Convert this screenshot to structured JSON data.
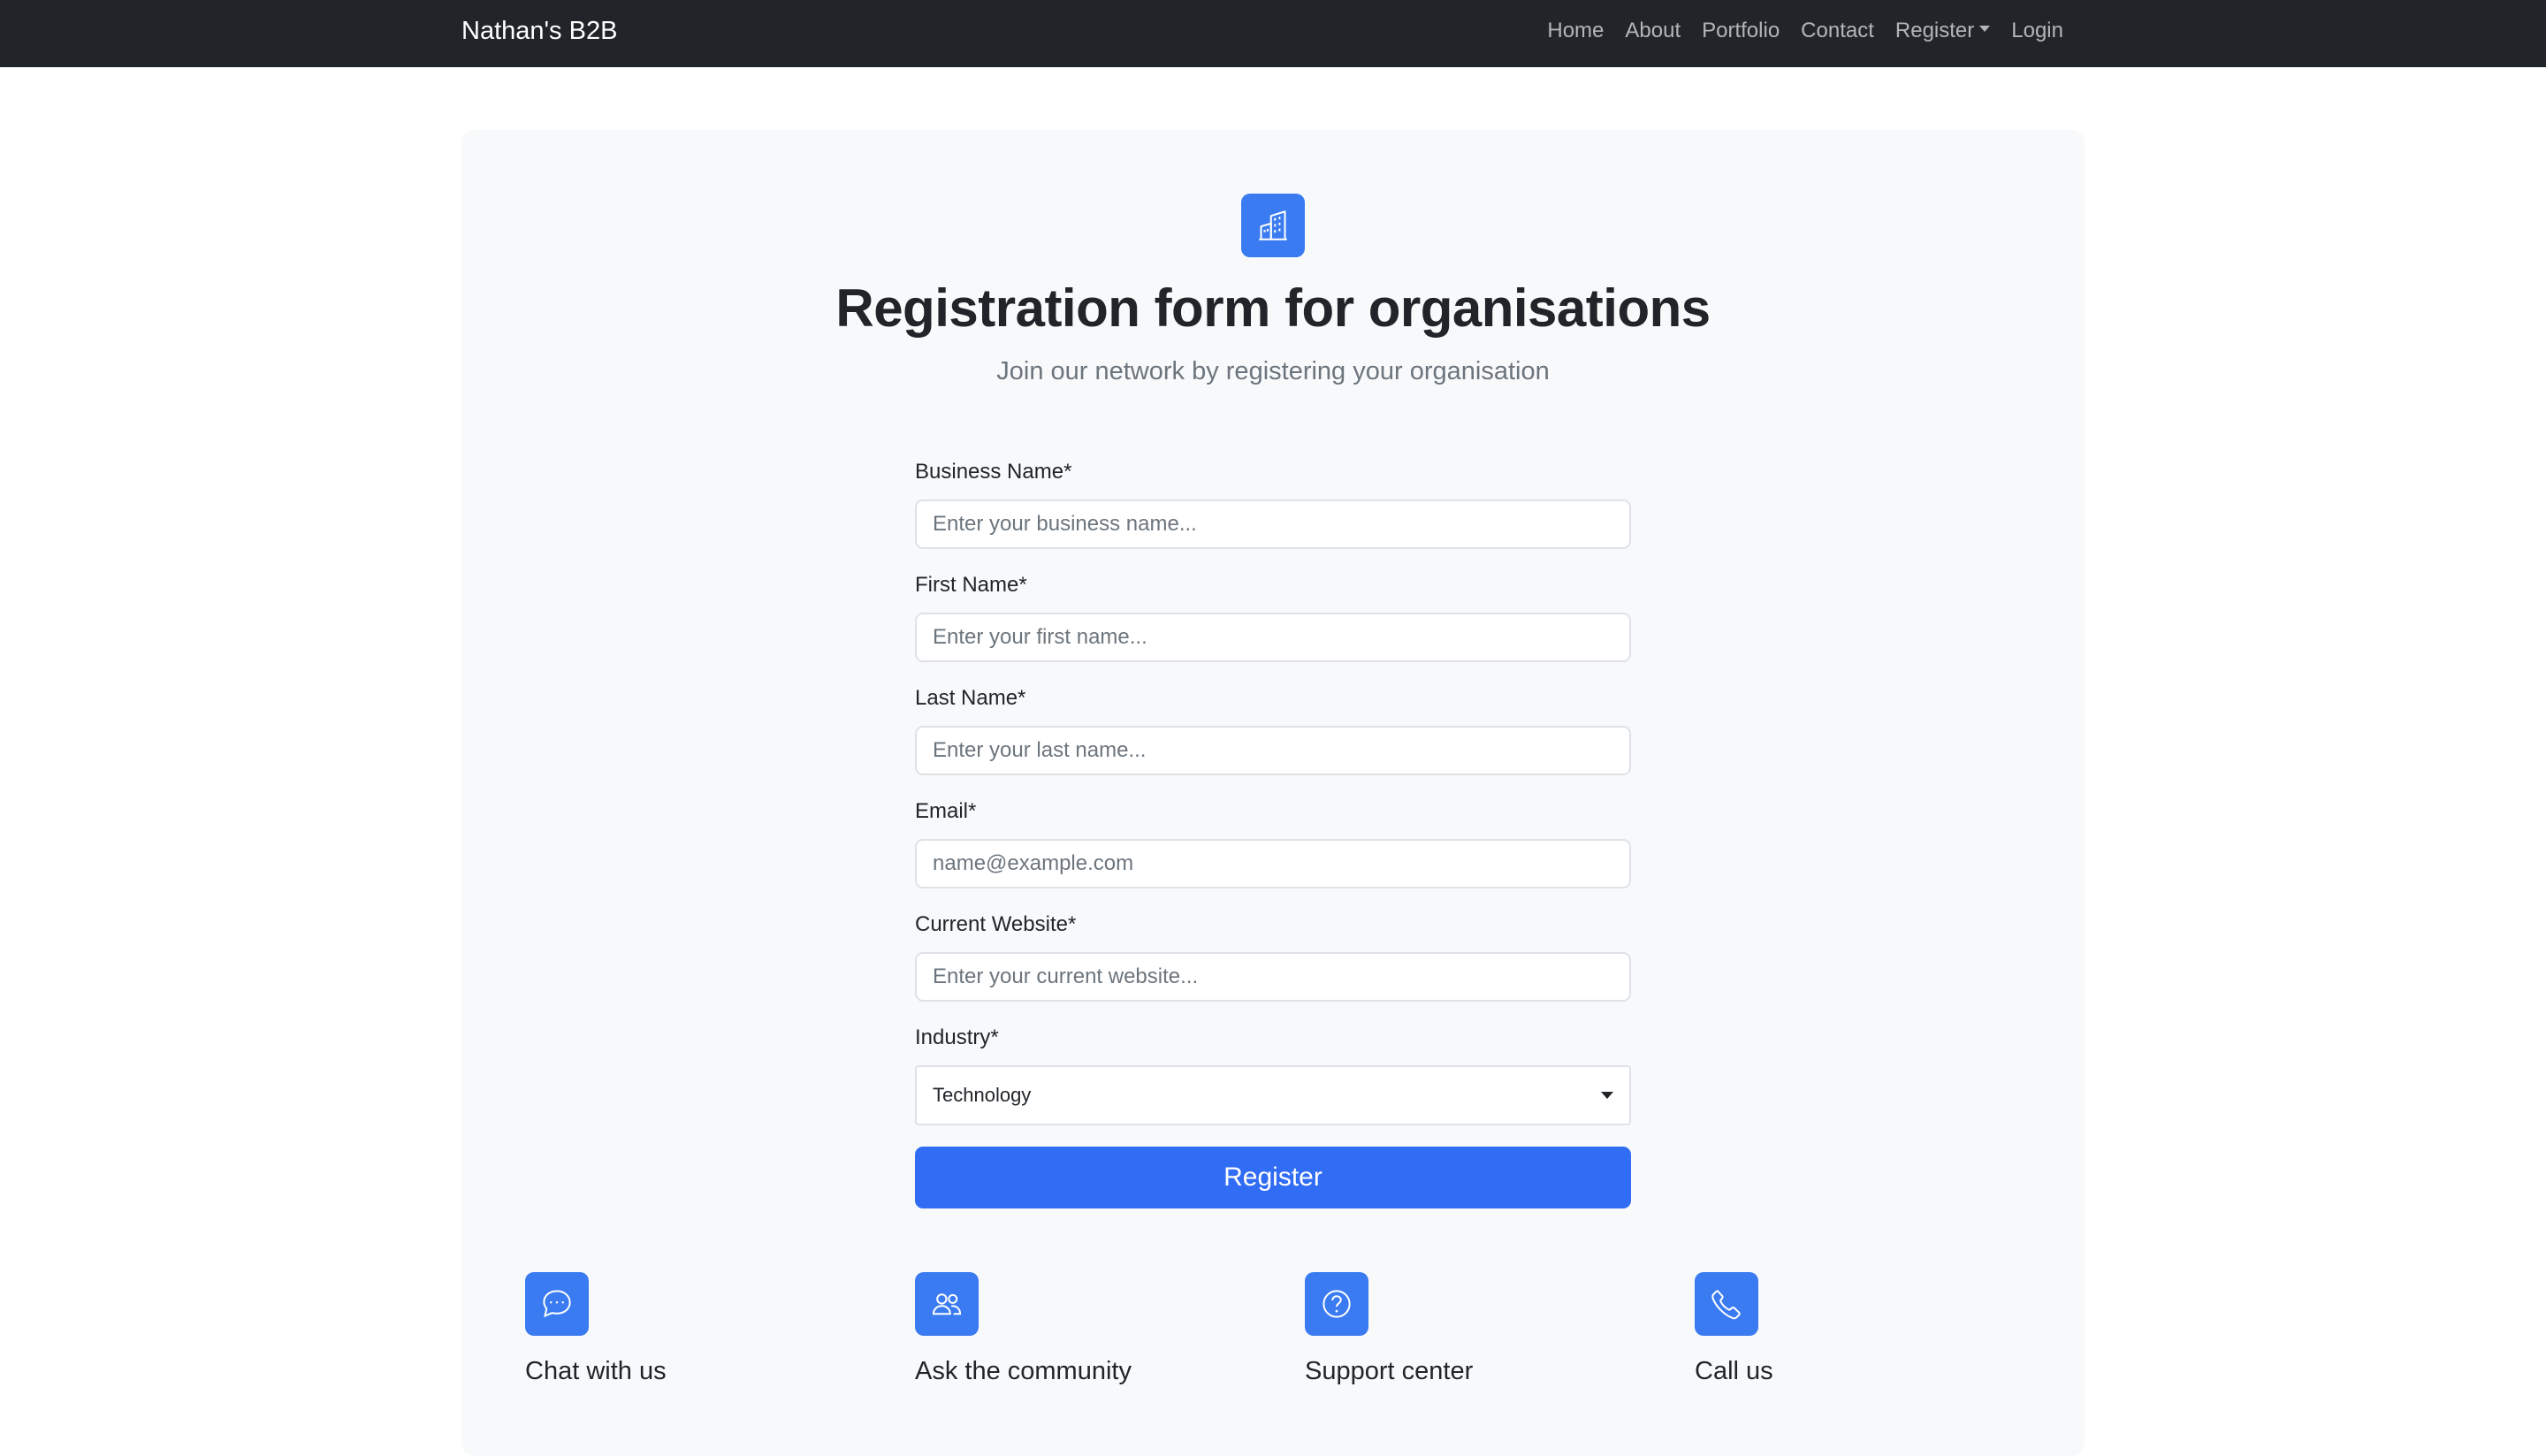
{
  "navbar": {
    "brand": "Nathan's B2B",
    "links": [
      {
        "label": "Home"
      },
      {
        "label": "About"
      },
      {
        "label": "Portfolio"
      },
      {
        "label": "Contact"
      },
      {
        "label": "Register"
      },
      {
        "label": "Login"
      }
    ]
  },
  "hero": {
    "icon": "building-icon",
    "title": "Registration form for organisations",
    "subtitle": "Join our network by registering your organisation"
  },
  "form": {
    "business_name": {
      "label": "Business Name*",
      "placeholder": "Enter your business name...",
      "value": ""
    },
    "first_name": {
      "label": "First Name*",
      "placeholder": "Enter your first name...",
      "value": ""
    },
    "last_name": {
      "label": "Last Name*",
      "placeholder": "Enter your last name...",
      "value": ""
    },
    "email": {
      "label": "Email*",
      "placeholder": "name@example.com",
      "value": ""
    },
    "website": {
      "label": "Current Website*",
      "placeholder": "Enter your current website...",
      "value": ""
    },
    "industry": {
      "label": "Industry*",
      "selected": "Technology"
    },
    "submit_label": "Register"
  },
  "features": [
    {
      "icon": "chat-icon",
      "title": "Chat with us"
    },
    {
      "icon": "people-icon",
      "title": "Ask the community"
    },
    {
      "icon": "question-icon",
      "title": "Support center"
    },
    {
      "icon": "phone-icon",
      "title": "Call us"
    }
  ],
  "colors": {
    "navbar_bg": "#212529",
    "accent": "#316cf4",
    "icon_bg": "#3a7bf1",
    "panel_bg": "#f8f9fa"
  }
}
